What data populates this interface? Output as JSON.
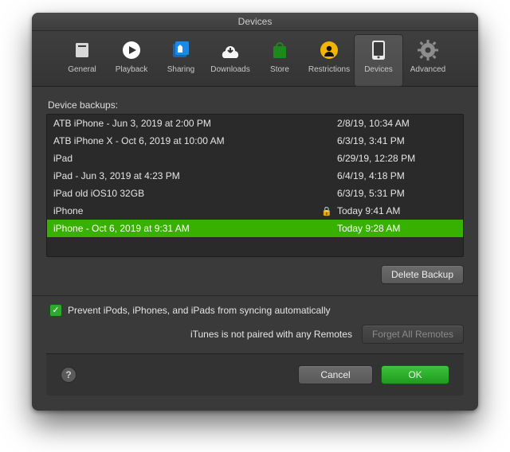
{
  "title": "Devices",
  "tabs": [
    {
      "label": "General"
    },
    {
      "label": "Playback"
    },
    {
      "label": "Sharing"
    },
    {
      "label": "Downloads"
    },
    {
      "label": "Store"
    },
    {
      "label": "Restrictions"
    },
    {
      "label": "Devices"
    },
    {
      "label": "Advanced"
    }
  ],
  "labels": {
    "device_backups": "Device backups:",
    "prevent_sync": "Prevent iPods, iPhones, and iPads from syncing automatically",
    "remotes_status": "iTunes is not paired with any Remotes"
  },
  "buttons": {
    "delete_backup": "Delete Backup",
    "forget_remotes": "Forget All Remotes",
    "cancel": "Cancel",
    "ok": "OK"
  },
  "backups": [
    {
      "name": "ATB iPhone - Jun 3, 2019 at 2:00 PM",
      "locked": false,
      "date": "2/8/19, 10:34 AM",
      "selected": false
    },
    {
      "name": "ATB iPhone X - Oct 6, 2019 at 10:00 AM",
      "locked": false,
      "date": "6/3/19, 3:41 PM",
      "selected": false
    },
    {
      "name": "iPad",
      "locked": false,
      "date": "6/29/19, 12:28 PM",
      "selected": false
    },
    {
      "name": "iPad - Jun 3, 2019 at 4:23 PM",
      "locked": false,
      "date": "6/4/19, 4:18 PM",
      "selected": false
    },
    {
      "name": "iPad old iOS10 32GB",
      "locked": false,
      "date": "6/3/19, 5:31 PM",
      "selected": false
    },
    {
      "name": "iPhone",
      "locked": true,
      "date": "Today 9:41 AM",
      "selected": false
    },
    {
      "name": "iPhone - Oct 6, 2019 at 9:31 AM",
      "locked": false,
      "date": "Today 9:28 AM",
      "selected": true
    }
  ]
}
